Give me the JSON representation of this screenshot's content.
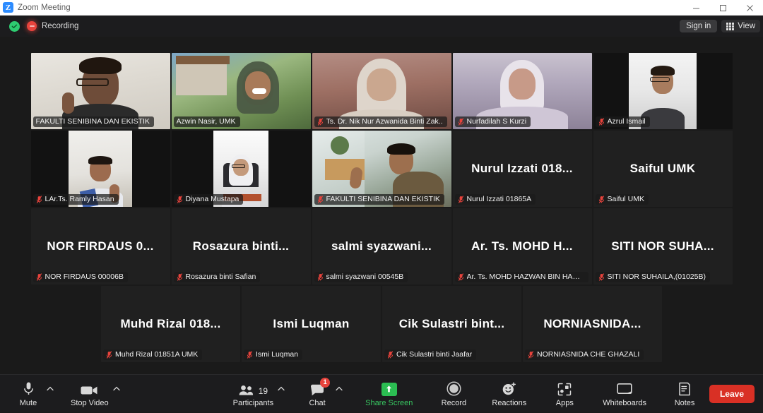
{
  "window": {
    "title": "Zoom Meeting",
    "logo_letter": "Z",
    "minimize_label": "Minimize",
    "maximize_label": "Maximize",
    "close_label": "Close"
  },
  "topbar": {
    "recording_label": "Recording",
    "sign_in_label": "Sign in",
    "view_label": "View",
    "encryption_icon": "shield-check-icon",
    "recording_icon": "recording-icon",
    "view_icon": "grid-icon"
  },
  "gallery": {
    "rows": [
      [
        {
          "name": "FAKULTI SENIBINA DAN EKISTIK",
          "video": true,
          "active_speaker": true,
          "muted": false,
          "bg": "bgA",
          "fit": "full"
        },
        {
          "name": "Azwin Nasir, UMK",
          "video": true,
          "active_speaker": false,
          "muted": false,
          "bg": "bgB",
          "fit": "full"
        },
        {
          "name": "Ts. Dr. Nik Nur Azwanida Binti Zak..",
          "video": true,
          "active_speaker": false,
          "muted": true,
          "bg": "bgC",
          "fit": "full"
        },
        {
          "name": "Nurfadilah S Kurzi",
          "video": true,
          "active_speaker": false,
          "muted": true,
          "bg": "bgD",
          "fit": "full"
        },
        {
          "name": "Azrul Ismail",
          "video": true,
          "active_speaker": false,
          "muted": true,
          "bg": "bgE",
          "fit": "narrow"
        }
      ],
      [
        {
          "name": "LAr.Ts. Ramly Hasan",
          "video": true,
          "active_speaker": false,
          "muted": true,
          "bg": "bgF",
          "fit": "narrow2"
        },
        {
          "name": "Diyana Mustapa",
          "video": true,
          "active_speaker": false,
          "muted": true,
          "bg": "bgG",
          "fit": "narrow3"
        },
        {
          "name": "FAKULTI SENIBINA DAN EKISTIK",
          "video": true,
          "active_speaker": false,
          "muted": true,
          "bg": "bgH",
          "fit": "full"
        },
        {
          "name": "Nurul Izzati 01865A",
          "display": "Nurul Izzati 018...",
          "video": false,
          "active_speaker": false,
          "muted": true
        },
        {
          "name": "Saiful UMK",
          "display": "Saiful UMK",
          "video": false,
          "active_speaker": false,
          "muted": true
        }
      ],
      [
        {
          "name": "NOR FIRDAUS 00006B",
          "display": "NOR FIRDAUS 0...",
          "video": false,
          "active_speaker": false,
          "muted": true
        },
        {
          "name": "Rosazura binti Safian",
          "display": "Rosazura binti...",
          "video": false,
          "active_speaker": false,
          "muted": true
        },
        {
          "name": "salmi syazwani 00545B",
          "display": "salmi syazwani...",
          "video": false,
          "active_speaker": false,
          "muted": true
        },
        {
          "name": "Ar. Ts. MOHD HAZWAN BIN HAMI...",
          "display": "Ar. Ts. MOHD H...",
          "video": false,
          "active_speaker": false,
          "muted": true
        },
        {
          "name": "SITI NOR SUHAILA,(01025B)",
          "display": "SITI NOR SUHA...",
          "video": false,
          "active_speaker": false,
          "muted": true
        }
      ],
      [
        {
          "name": "Muhd Rizal 01851A UMK",
          "display": "Muhd Rizal 018...",
          "video": false,
          "active_speaker": false,
          "muted": true
        },
        {
          "name": "Ismi Luqman",
          "display": "Ismi Luqman",
          "video": false,
          "active_speaker": false,
          "muted": true
        },
        {
          "name": "Cik Sulastri binti Jaafar",
          "display": "Cik Sulastri bint...",
          "video": false,
          "active_speaker": false,
          "muted": true
        },
        {
          "name": "NORNIASNIDA CHE GHAZALI",
          "display": "NORNIASNIDA...",
          "video": false,
          "active_speaker": false,
          "muted": true
        }
      ]
    ]
  },
  "controls": {
    "mute": {
      "label": "Mute",
      "icon": "microphone-icon"
    },
    "stop_video": {
      "label": "Stop Video",
      "icon": "camera-icon"
    },
    "participants": {
      "label": "Participants",
      "count": "19",
      "icon": "people-icon"
    },
    "chat": {
      "label": "Chat",
      "badge": "1",
      "icon": "chat-bubble-icon"
    },
    "share_screen": {
      "label": "Share Screen",
      "icon": "share-screen-icon"
    },
    "record": {
      "label": "Record",
      "icon": "record-circle-icon"
    },
    "reactions": {
      "label": "Reactions",
      "icon": "smiley-plus-icon"
    },
    "apps": {
      "label": "Apps",
      "icon": "apps-icon"
    },
    "whiteboards": {
      "label": "Whiteboards",
      "icon": "whiteboard-icon"
    },
    "notes": {
      "label": "Notes",
      "icon": "notes-icon"
    },
    "leave": {
      "label": "Leave"
    }
  },
  "colors": {
    "active_speaker_border": "#cfe03a",
    "recording_red": "#e8433c",
    "share_green": "#2bbd52",
    "leave_red": "#d93025",
    "accent_blue": "#2d8cff"
  }
}
